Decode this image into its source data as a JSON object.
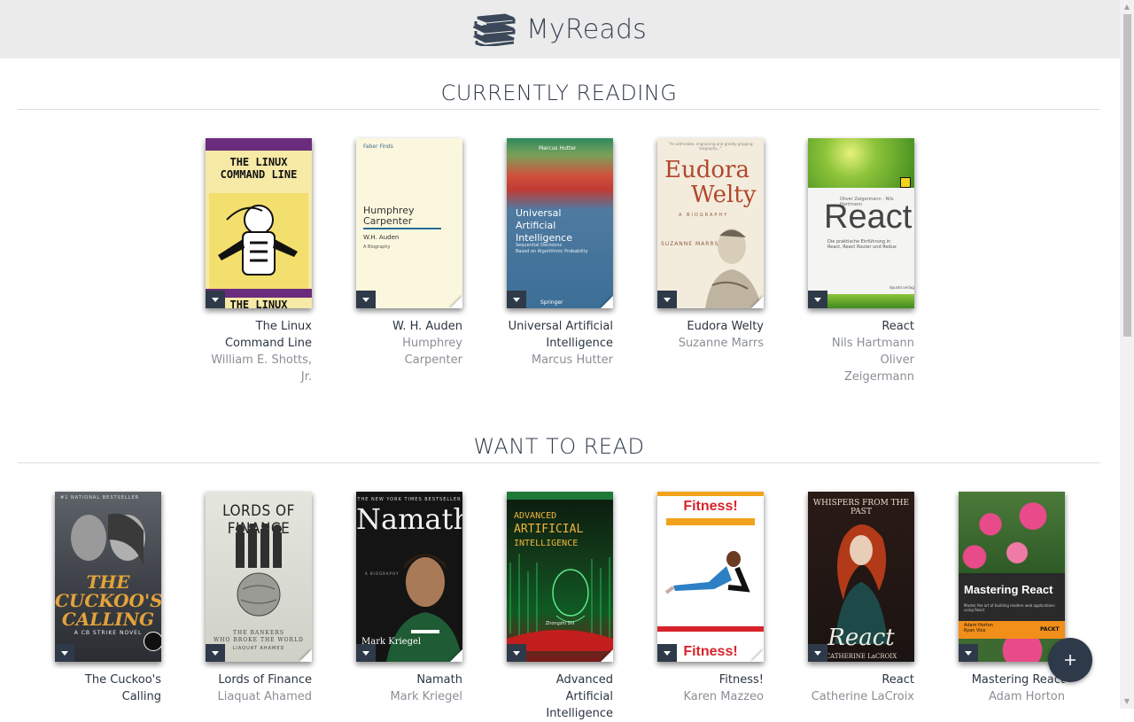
{
  "app": {
    "title": "MyReads"
  },
  "shelves": [
    {
      "title": "CURRENTLY READING",
      "books": [
        {
          "title_lines": [
            "The Linux",
            "Command Line"
          ],
          "authors": [
            "William E. Shotts, Jr."
          ],
          "cover_text": "THE LINUX COMMAND LINE"
        },
        {
          "title_lines": [
            "W. H. Auden"
          ],
          "authors": [
            "Humphrey Carpenter"
          ],
          "cover_text": "Humphrey Carpenter"
        },
        {
          "title_lines": [
            "Universal Artificial",
            "Intelligence"
          ],
          "authors": [
            "Marcus Hutter"
          ],
          "cover_text": "Universal Artificial Intelligence"
        },
        {
          "title_lines": [
            "Eudora Welty"
          ],
          "authors": [
            "Suzanne Marrs"
          ],
          "cover_text": "Eudora Welty"
        },
        {
          "title_lines": [
            "React"
          ],
          "authors": [
            "Nils Hartmann",
            "Oliver Zeigermann"
          ],
          "cover_text": "React"
        }
      ]
    },
    {
      "title": "WANT TO READ",
      "books": [
        {
          "title_lines": [
            "The Cuckoo's",
            "Calling"
          ],
          "authors": [],
          "cover_text": "THE CUCKOO'S CALLING"
        },
        {
          "title_lines": [
            "Lords of Finance"
          ],
          "authors": [
            "Liaquat Ahamed"
          ],
          "cover_text": "LORDS OF FINANCE"
        },
        {
          "title_lines": [
            "Namath"
          ],
          "authors": [
            "Mark Kriegel"
          ],
          "cover_text": "Namath"
        },
        {
          "title_lines": [
            "Advanced Artificial",
            "Intelligence"
          ],
          "authors": [],
          "cover_text": "ADVANCED ARTIFICIAL INTELLIGENCE"
        },
        {
          "title_lines": [
            "Fitness!"
          ],
          "authors": [
            "Karen Mazzeo"
          ],
          "cover_text": "Fitness!"
        },
        {
          "title_lines": [
            "React"
          ],
          "authors": [
            "Catherine LaCroix"
          ],
          "cover_text": "React"
        },
        {
          "title_lines": [
            "Mastering React"
          ],
          "authors": [
            "Adam Horton"
          ],
          "cover_text": "Mastering React"
        }
      ]
    }
  ],
  "add_button": {
    "label": "+"
  },
  "icons": {
    "logo": "books-stack-icon",
    "changer": "triangle-down-icon",
    "add": "plus-icon"
  },
  "colors": {
    "accent": "#2e3a49",
    "topbar": "#ebebeb",
    "author": "#8a8f96"
  }
}
